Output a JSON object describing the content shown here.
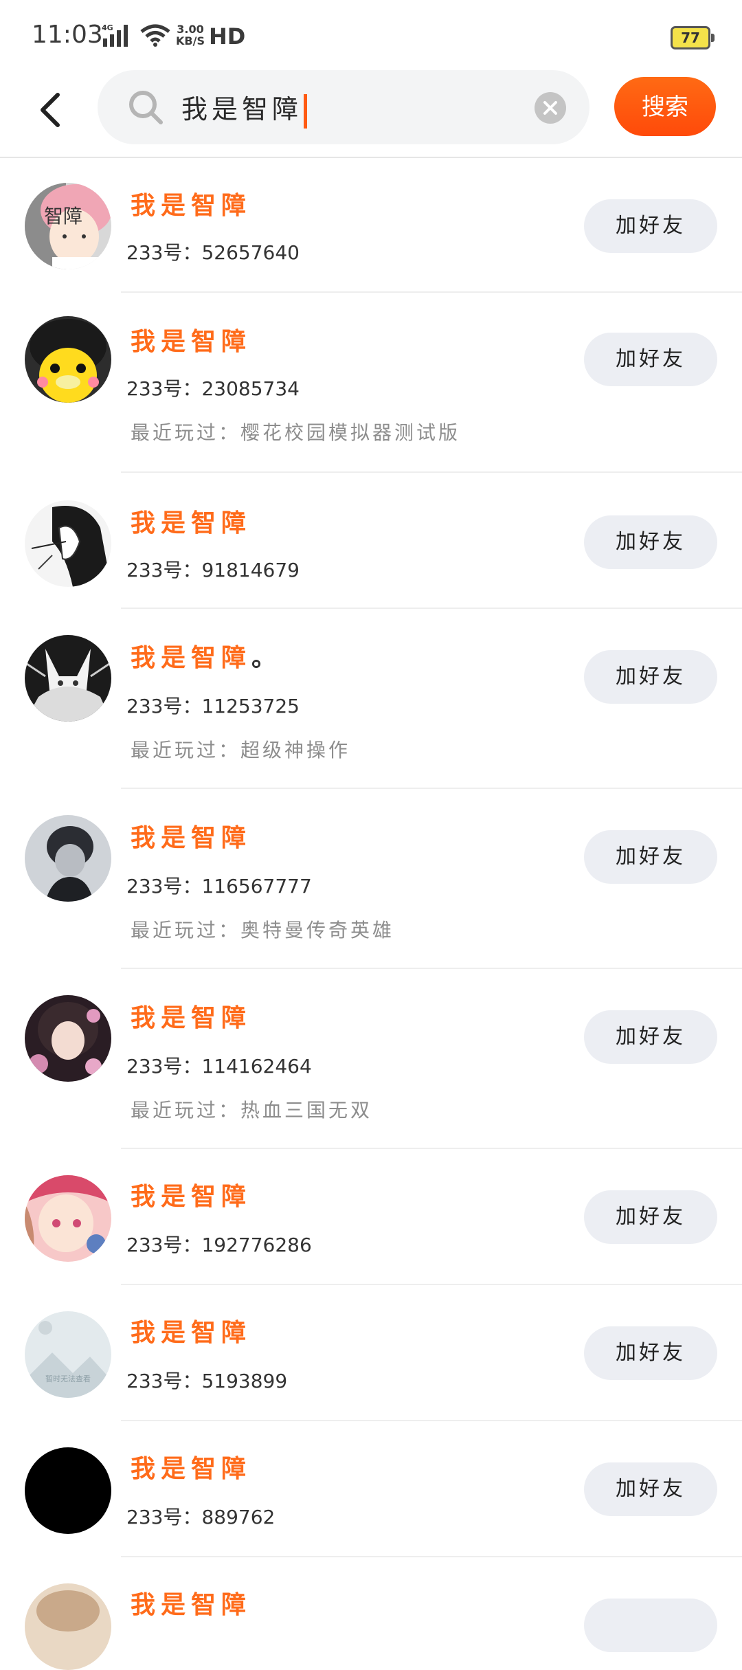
{
  "status": {
    "time": "11:03",
    "network": "4G",
    "speed_value": "3.00",
    "speed_unit": "KB/S",
    "hd": "HD",
    "battery": "77"
  },
  "search": {
    "query": "我是智障",
    "button_label": "搜索"
  },
  "results": [
    {
      "name": "我是智障",
      "name_suffix": "",
      "uid": "233号：52657640",
      "played": "",
      "add_label": "加好友",
      "avatar_icon": "avatar-anime-girl-pink-hair"
    },
    {
      "name": "我是智障",
      "name_suffix": "",
      "uid": "233号：23085734",
      "played": "最近玩过：樱花校园模拟器测试版",
      "add_label": "加好友",
      "avatar_icon": "avatar-yellow-duck"
    },
    {
      "name": "我是智障",
      "name_suffix": "",
      "uid": "233号：91814679",
      "played": "",
      "add_label": "加好友",
      "avatar_icon": "avatar-sketch-character"
    },
    {
      "name": "我是智障",
      "name_suffix": "。",
      "uid": "233号：11253725",
      "played": "最近玩过：超级神操作",
      "add_label": "加好友",
      "avatar_icon": "avatar-fox-mask"
    },
    {
      "name": "我是智障",
      "name_suffix": "",
      "uid": "233号：116567777",
      "played": "最近玩过：奥特曼传奇英雄",
      "add_label": "加好友",
      "avatar_icon": "avatar-dark-boy"
    },
    {
      "name": "我是智障",
      "name_suffix": "",
      "uid": "233号：114162464",
      "played": "最近玩过：热血三国无双",
      "add_label": "加好友",
      "avatar_icon": "avatar-anime-girl-flowers"
    },
    {
      "name": "我是智障",
      "name_suffix": "",
      "uid": "233号：192776286",
      "played": "",
      "add_label": "加好友",
      "avatar_icon": "avatar-anime-girl-pink"
    },
    {
      "name": "我是智障",
      "name_suffix": "",
      "uid": "233号：5193899",
      "played": "",
      "add_label": "加好友",
      "avatar_icon": "avatar-placeholder",
      "avatar_text": "暂时无法查看"
    },
    {
      "name": "我是智障",
      "name_suffix": "",
      "uid": "233号：889762",
      "played": "",
      "add_label": "加好友",
      "avatar_icon": "avatar-black"
    },
    {
      "name": "我是智障",
      "name_suffix": "",
      "uid": "",
      "played": "",
      "add_label": "",
      "avatar_icon": "avatar-partial"
    }
  ],
  "colors": {
    "accent": "#ff6b1a",
    "button_bg": "#eceef3"
  }
}
